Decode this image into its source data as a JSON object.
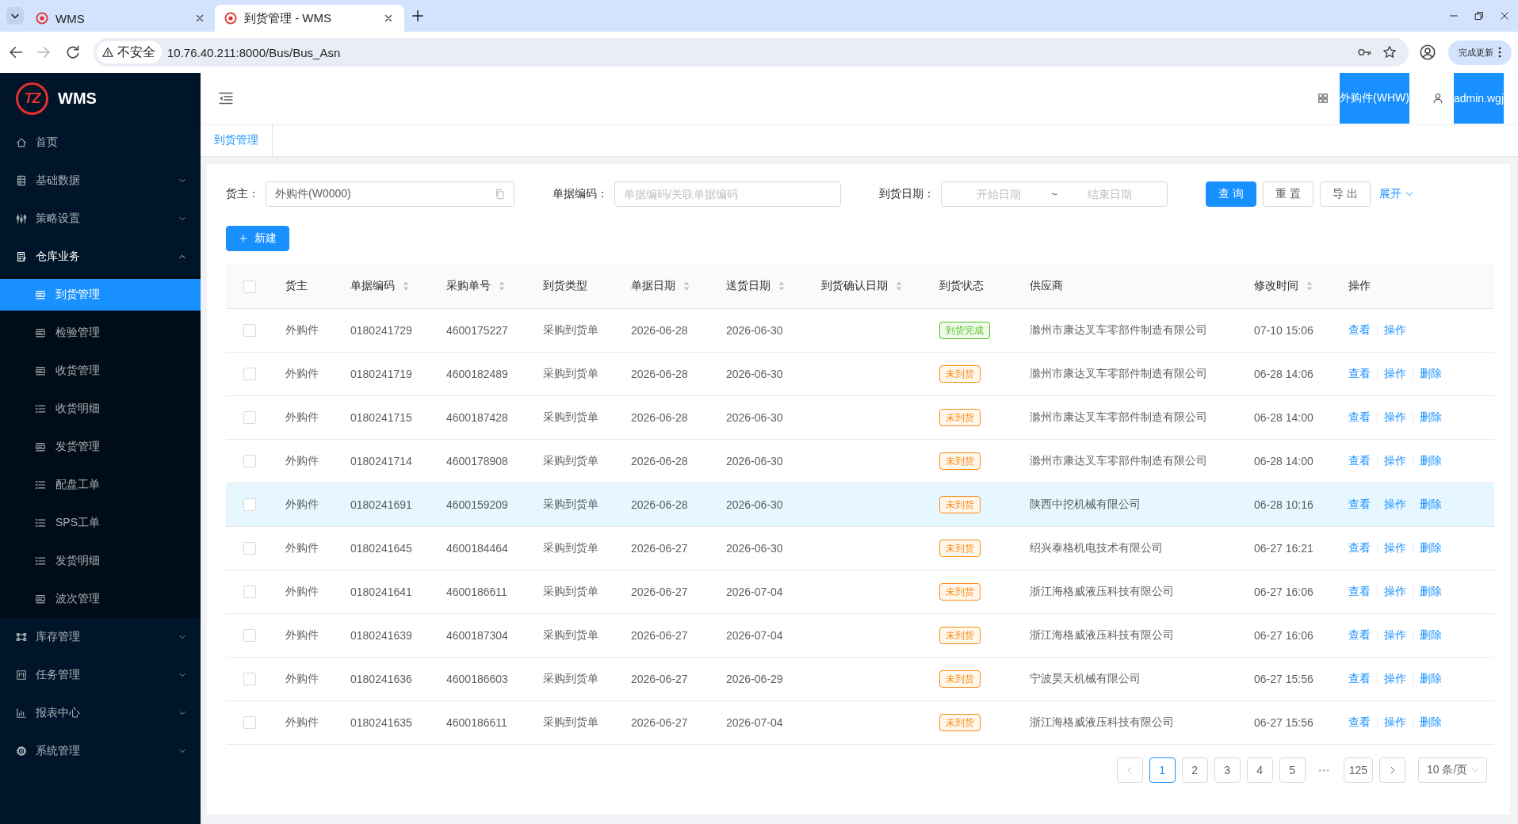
{
  "browser": {
    "tabs": [
      {
        "title": "WMS",
        "selected": false
      },
      {
        "title": "到货管理 - WMS",
        "selected": true
      }
    ],
    "security_label": "不安全",
    "url": "10.76.40.211:8000/Bus/Bus_Asn",
    "update_button": "完成更新"
  },
  "sidebar": {
    "logo_text": "TZ",
    "app_name": "WMS",
    "items": [
      {
        "kind": "link",
        "label": "首页"
      },
      {
        "kind": "submenu",
        "label": "基础数据",
        "expanded": false
      },
      {
        "kind": "submenu",
        "label": "策略设置",
        "expanded": false
      },
      {
        "kind": "submenu",
        "label": "仓库业务",
        "expanded": true,
        "children": [
          {
            "label": "到货管理",
            "selected": true
          },
          {
            "label": "检验管理",
            "selected": false
          },
          {
            "label": "收货管理",
            "selected": false
          },
          {
            "label": "收货明细",
            "selected": false
          },
          {
            "label": "发货管理",
            "selected": false
          },
          {
            "label": "配盘工单",
            "selected": false
          },
          {
            "label": "SPS工单",
            "selected": false
          },
          {
            "label": "发货明细",
            "selected": false
          },
          {
            "label": "波次管理",
            "selected": false
          }
        ]
      },
      {
        "kind": "submenu",
        "label": "库存管理",
        "expanded": false
      },
      {
        "kind": "submenu",
        "label": "任务管理",
        "expanded": false
      },
      {
        "kind": "submenu",
        "label": "报表中心",
        "expanded": false
      },
      {
        "kind": "submenu",
        "label": "系统管理",
        "expanded": false
      }
    ]
  },
  "header": {
    "warehouse": "外购件(WHW)",
    "user": "admin.wgj"
  },
  "page_tabs": [
    {
      "label": "到货管理",
      "selected": true
    }
  ],
  "filters": [
    {
      "kind": "select",
      "label": "货主：",
      "value": "外购件(W0000)"
    },
    {
      "kind": "text",
      "label": "单据编码：",
      "placeholder": "单据编码/关联单据编码"
    },
    {
      "kind": "date_range",
      "label": "到货日期：",
      "start_placeholder": "开始日期",
      "separator": "~",
      "end_placeholder": "结束日期"
    }
  ],
  "filter_buttons": [
    {
      "kind": "primary",
      "label": "查 询"
    },
    {
      "kind": "default",
      "label": "重 置"
    },
    {
      "kind": "default",
      "label": "导 出"
    }
  ],
  "expand_link": "展开",
  "new_button": "新建",
  "table": {
    "select_all": {
      "checked": false
    },
    "columns": [
      {
        "label": "货主",
        "sortable": false
      },
      {
        "label": "单据编码",
        "sortable": true
      },
      {
        "label": "采购单号",
        "sortable": true
      },
      {
        "label": "到货类型",
        "sortable": false
      },
      {
        "label": "单据日期",
        "sortable": true
      },
      {
        "label": "送货日期",
        "sortable": true
      },
      {
        "label": "到货确认日期",
        "sortable": true
      },
      {
        "label": "到货状态",
        "sortable": false
      },
      {
        "label": "供应商",
        "sortable": false
      },
      {
        "label": "修改时间",
        "sortable": true
      },
      {
        "label": "操作",
        "sortable": false
      }
    ],
    "rows": [
      {
        "checked": false,
        "hovered": false,
        "owner": "外购件",
        "doc_no": "0180241729",
        "po_no": "4600175227",
        "type": "采购到货单",
        "doc_date": "2026-06-28",
        "delivery_date": "2026-06-30",
        "status": {
          "label": "到货完成",
          "color": "#52c41a"
        },
        "supplier": "滁州市康达叉车零部件制造有限公司",
        "modified": "07-10 15:06",
        "actions": [
          "查看",
          "操作"
        ]
      },
      {
        "checked": false,
        "hovered": false,
        "owner": "外购件",
        "doc_no": "0180241719",
        "po_no": "4600182489",
        "type": "采购到货单",
        "doc_date": "2026-06-28",
        "delivery_date": "2026-06-30",
        "status": {
          "label": "未到货",
          "color": "#fa8c16"
        },
        "supplier": "滁州市康达叉车零部件制造有限公司",
        "modified": "06-28 14:06",
        "actions": [
          "查看",
          "操作",
          "删除"
        ]
      },
      {
        "checked": false,
        "hovered": false,
        "owner": "外购件",
        "doc_no": "0180241715",
        "po_no": "4600187428",
        "type": "采购到货单",
        "doc_date": "2026-06-28",
        "delivery_date": "2026-06-30",
        "status": {
          "label": "未到货",
          "color": "#fa8c16"
        },
        "supplier": "滁州市康达叉车零部件制造有限公司",
        "modified": "06-28 14:00",
        "actions": [
          "查看",
          "操作",
          "删除"
        ]
      },
      {
        "checked": false,
        "hovered": false,
        "owner": "外购件",
        "doc_no": "0180241714",
        "po_no": "4600178908",
        "type": "采购到货单",
        "doc_date": "2026-06-28",
        "delivery_date": "2026-06-30",
        "status": {
          "label": "未到货",
          "color": "#fa8c16"
        },
        "supplier": "滁州市康达叉车零部件制造有限公司",
        "modified": "06-28 14:00",
        "actions": [
          "查看",
          "操作",
          "删除"
        ]
      },
      {
        "checked": false,
        "hovered": true,
        "owner": "外购件",
        "doc_no": "0180241691",
        "po_no": "4600159209",
        "type": "采购到货单",
        "doc_date": "2026-06-28",
        "delivery_date": "2026-06-30",
        "status": {
          "label": "未到货",
          "color": "#fa8c16"
        },
        "supplier": "陕西中挖机械有限公司",
        "modified": "06-28 10:16",
        "actions": [
          "查看",
          "操作",
          "删除"
        ]
      },
      {
        "checked": false,
        "hovered": false,
        "owner": "外购件",
        "doc_no": "0180241645",
        "po_no": "4600184464",
        "type": "采购到货单",
        "doc_date": "2026-06-27",
        "delivery_date": "2026-06-30",
        "status": {
          "label": "未到货",
          "color": "#fa8c16"
        },
        "supplier": "绍兴泰格机电技术有限公司",
        "modified": "06-27 16:21",
        "actions": [
          "查看",
          "操作",
          "删除"
        ]
      },
      {
        "checked": false,
        "hovered": false,
        "owner": "外购件",
        "doc_no": "0180241641",
        "po_no": "4600186611",
        "type": "采购到货单",
        "doc_date": "2026-06-27",
        "delivery_date": "2026-07-04",
        "status": {
          "label": "未到货",
          "color": "#fa8c16"
        },
        "supplier": "浙江海格威液压科技有限公司",
        "modified": "06-27 16:06",
        "actions": [
          "查看",
          "操作",
          "删除"
        ]
      },
      {
        "checked": false,
        "hovered": false,
        "owner": "外购件",
        "doc_no": "0180241639",
        "po_no": "4600187304",
        "type": "采购到货单",
        "doc_date": "2026-06-27",
        "delivery_date": "2026-07-04",
        "status": {
          "label": "未到货",
          "color": "#fa8c16"
        },
        "supplier": "浙江海格威液压科技有限公司",
        "modified": "06-27 16:06",
        "actions": [
          "查看",
          "操作",
          "删除"
        ]
      },
      {
        "checked": false,
        "hovered": false,
        "owner": "外购件",
        "doc_no": "0180241636",
        "po_no": "4600186603",
        "type": "采购到货单",
        "doc_date": "2026-06-27",
        "delivery_date": "2026-06-29",
        "status": {
          "label": "未到货",
          "color": "#fa8c16"
        },
        "supplier": "宁波昊天机械有限公司",
        "modified": "06-27 15:56",
        "actions": [
          "查看",
          "操作",
          "删除"
        ]
      },
      {
        "checked": false,
        "hovered": false,
        "owner": "外购件",
        "doc_no": "0180241635",
        "po_no": "4600186611",
        "type": "采购到货单",
        "doc_date": "2026-06-27",
        "delivery_date": "2026-07-04",
        "status": {
          "label": "未到货",
          "color": "#fa8c16"
        },
        "supplier": "浙江海格威液压科技有限公司",
        "modified": "06-27 15:56",
        "actions": [
          "查看",
          "操作",
          "删除"
        ]
      }
    ]
  },
  "pagination": {
    "prev": {
      "disabled": true
    },
    "pages": [
      {
        "label": "1",
        "selected": true
      },
      {
        "label": "2",
        "selected": false
      },
      {
        "label": "3",
        "selected": false
      },
      {
        "label": "4",
        "selected": false
      },
      {
        "label": "5",
        "selected": false
      }
    ],
    "ellipsis": "•••",
    "last_page": {
      "label": "125",
      "selected": false
    },
    "next": {
      "disabled": false
    },
    "page_size": "10 条/页"
  }
}
